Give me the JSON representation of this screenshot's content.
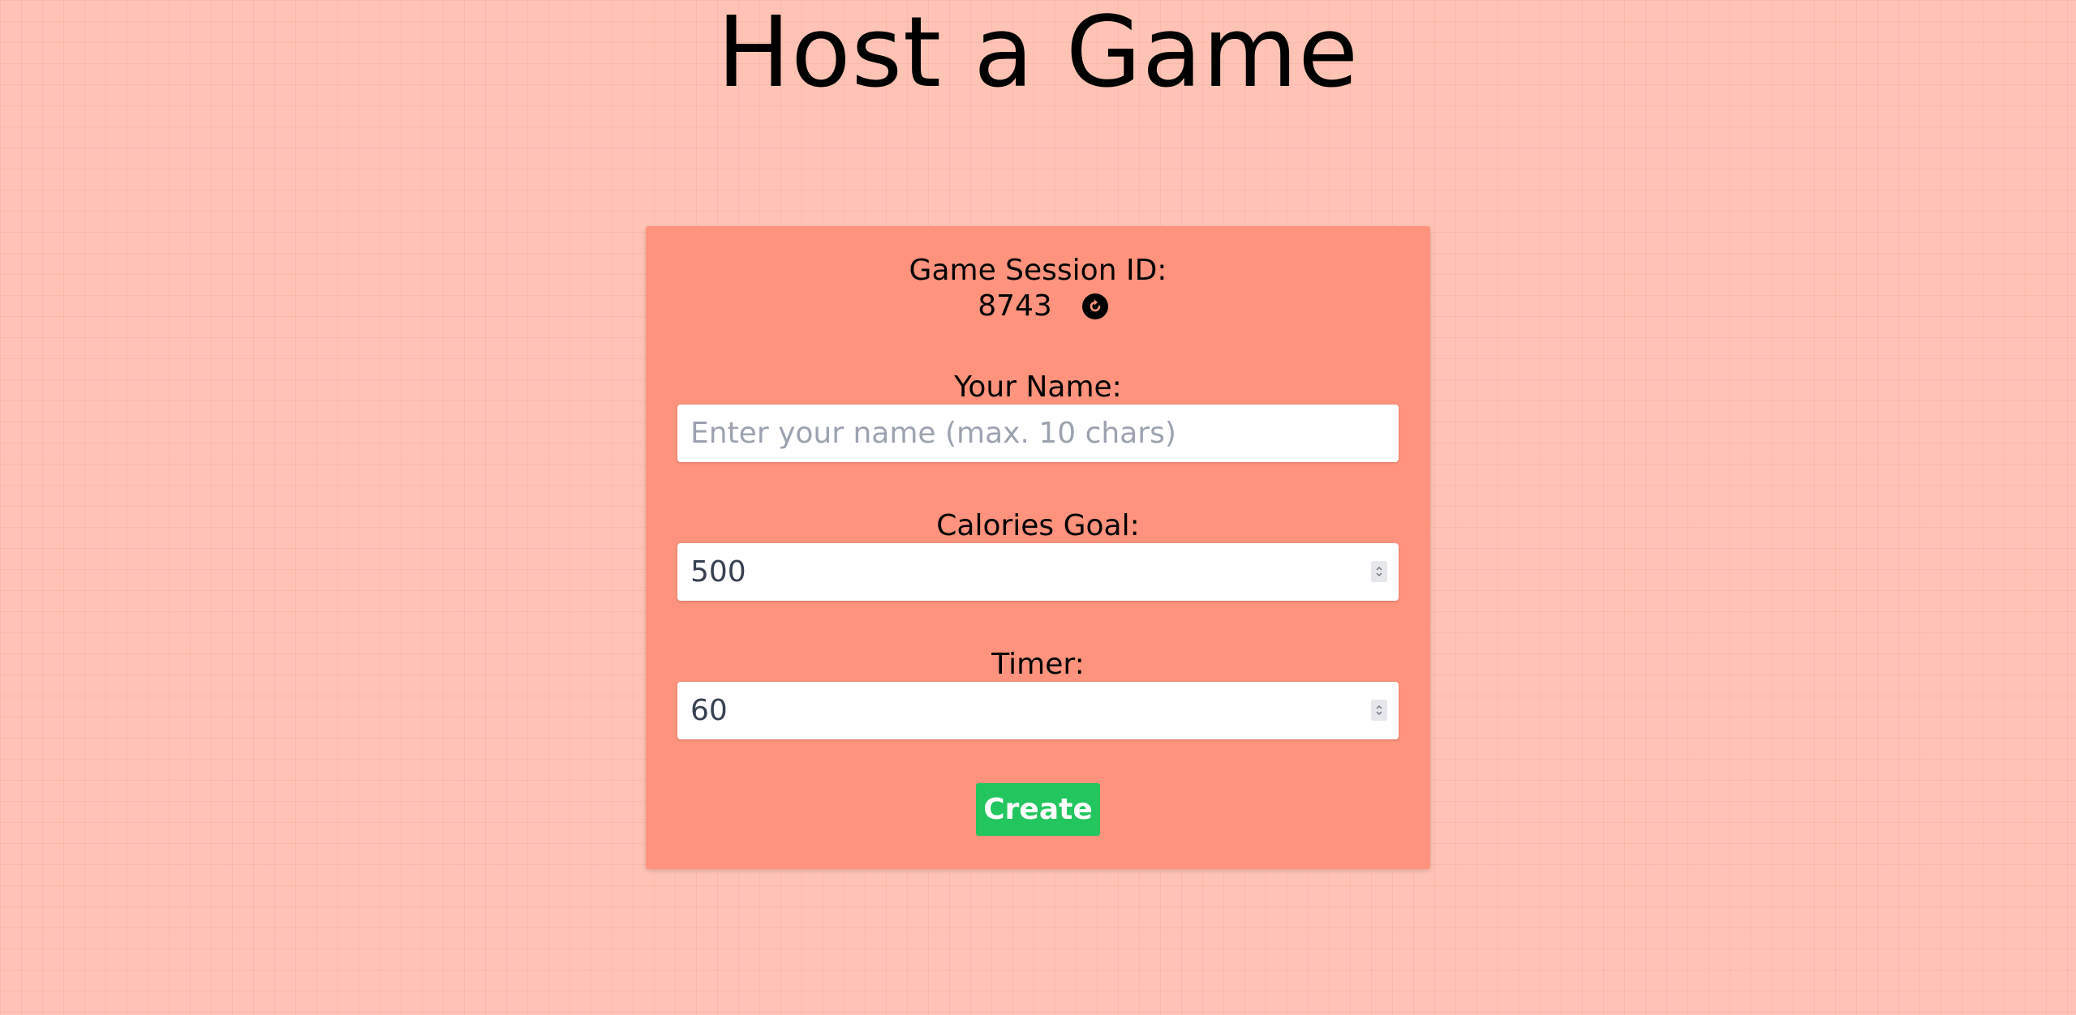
{
  "page": {
    "title": "Host a Game"
  },
  "session": {
    "label": "Game Session ID:",
    "id": "8743",
    "refresh_icon": "refresh-icon"
  },
  "name_field": {
    "label": "Your Name:",
    "value": "",
    "placeholder": "Enter your name (max. 10 chars)"
  },
  "calories_field": {
    "label": "Calories Goal:",
    "value": "500",
    "spinner_icon": "spinner-arrows-icon"
  },
  "timer_field": {
    "label": "Timer:",
    "value": "60",
    "spinner_icon": "spinner-arrows-icon"
  },
  "create_button": {
    "label": "Create"
  },
  "colors": {
    "background": "#fec3b5",
    "card": "#ff937d",
    "button": "#22c55e"
  }
}
